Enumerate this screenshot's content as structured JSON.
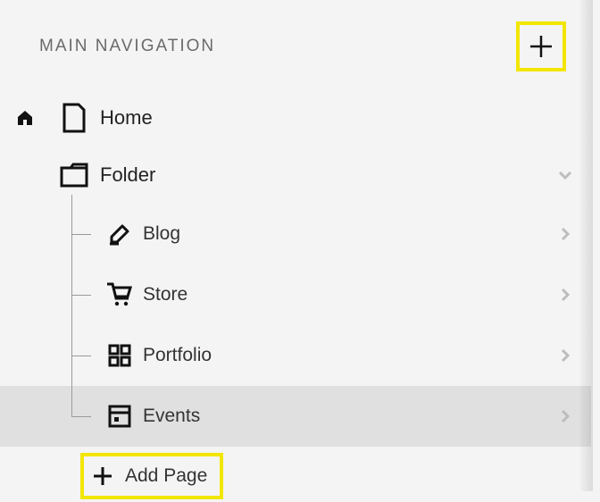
{
  "header": {
    "title": "MAIN NAVIGATION"
  },
  "nav": {
    "home": {
      "label": "Home"
    },
    "folder": {
      "label": "Folder"
    },
    "children": [
      {
        "label": "Blog",
        "icon": "pen-icon"
      },
      {
        "label": "Store",
        "icon": "cart-icon"
      },
      {
        "label": "Portfolio",
        "icon": "grid-icon"
      },
      {
        "label": "Events",
        "icon": "calendar-icon",
        "selected": true
      }
    ],
    "addPage": {
      "label": "Add Page"
    }
  },
  "colors": {
    "highlight": "#f2e600",
    "text": "#111111",
    "mutedText": "#6a6a6a",
    "selectedBg": "#e0e0e0",
    "panelBg": "#f4f4f4"
  }
}
